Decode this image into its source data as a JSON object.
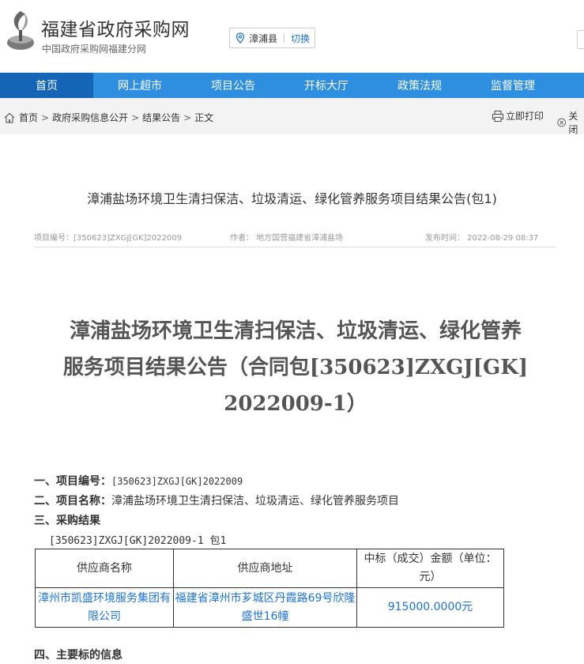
{
  "header": {
    "site_title": "福建省政府采购网",
    "site_subtitle": "中国政府采购网福建分网",
    "region": "漳浦县",
    "region_switch": "切换"
  },
  "nav": {
    "items": [
      "首页",
      "网上超市",
      "项目公告",
      "开标大厅",
      "政策法规",
      "监督管理"
    ],
    "active": "首页"
  },
  "breadcrumb": {
    "items": [
      "首页",
      "政府采购信息公开",
      "结果公告",
      "正文"
    ],
    "separator": ">",
    "print_label": "立即打印",
    "close_label": "关闭"
  },
  "article": {
    "title": "漳浦盐场环境卫生清扫保洁、垃圾清运、绿化管养服务项目结果公告(包1)",
    "meta_project_no": "项目编号：[350623]ZXGJ[GK]2022009",
    "meta_author": "作者： 地方国营福建省漳浦盐场",
    "meta_time": "发布时间： 2022-08-29 08:37",
    "big_title_lines": [
      "漳浦盐场环境卫生清扫保洁、垃圾清运、绿化管养",
      "服务项目结果公告（合同包[350623]ZXGJ[GK]",
      "2022009-1）"
    ],
    "sec1_label": "一、项目编号：",
    "sec1_value": "[350623]ZXGJ[GK]2022009",
    "sec2_label": "二、项目名称：",
    "sec2_value": "漳浦盐场环境卫生清扫保洁、垃圾清运、绿化管养服务项目",
    "sec3_label": "三、采购结果",
    "package_line": "[350623]ZXGJ[GK]2022009-1 包1",
    "table": {
      "headers": [
        "供应商名称",
        "供应商地址",
        "中标（成交）金额（单位：元）"
      ],
      "rows": [
        [
          "漳州市凯盛环境服务集团有限公司",
          "福建省漳州市芗城区丹霞路69号欣隆盛世16幢",
          "915000.0000元"
        ]
      ]
    },
    "sec4_label": "四、主要标的信息"
  },
  "colors": {
    "nav_bg": "#2e8ee0",
    "nav_active": "#1465b5",
    "link": "#1a73d8"
  }
}
